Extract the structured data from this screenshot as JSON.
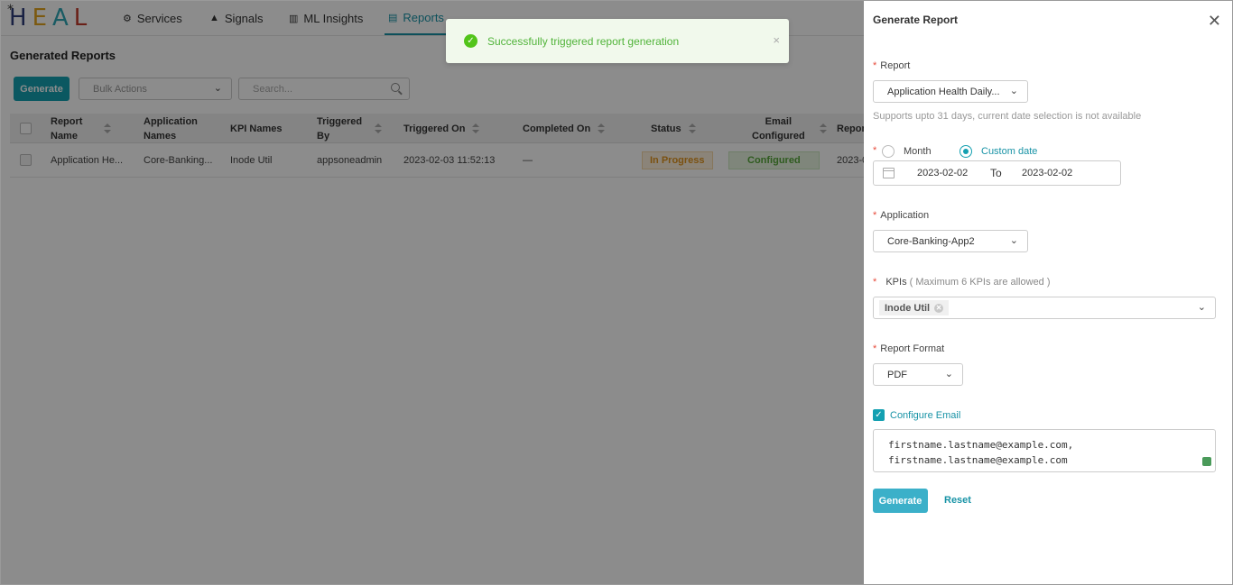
{
  "nav": {
    "logo": "HEAL",
    "items": [
      {
        "label": "Services",
        "icon": "gears-icon"
      },
      {
        "label": "Signals",
        "icon": "warning-icon"
      },
      {
        "label": "ML Insights",
        "icon": "bar-chart-icon"
      },
      {
        "label": "Reports",
        "icon": "document-icon",
        "active": true
      }
    ]
  },
  "page": {
    "title": "Generated Reports",
    "generate_label": "Generate",
    "bulk_actions_placeholder": "Bulk Actions",
    "search_placeholder": "Search..."
  },
  "table": {
    "headers": [
      "Report Name",
      "Application Names",
      "KPI Names",
      "Triggered By",
      "Triggered On",
      "Completed On",
      "Status",
      "Email Configured",
      "Repor"
    ],
    "header_lines": {
      "report_name": [
        "Report",
        "Name"
      ],
      "application_names": [
        "Application",
        "Names"
      ],
      "triggered_by": [
        "Triggered",
        "By"
      ],
      "email_configured": [
        "Email",
        "Configured"
      ]
    },
    "rows": [
      {
        "report_name": "Application He...",
        "application_names": "Core-Banking...",
        "kpi_names": "Inode Util",
        "triggered_by": "appsoneadmin",
        "triggered_on": "2023-02-03 11:52:13",
        "completed_on": "—",
        "status": "In Progress",
        "email_configured": "Configured",
        "report_trunc": "2023-0"
      }
    ]
  },
  "toast": {
    "message": "Successfully triggered report generation",
    "close": "×"
  },
  "drawer": {
    "title": "Generate Report",
    "close": "✕",
    "report_label": "Report",
    "report_value": "Application Health Daily...",
    "report_hint": "Supports upto 31 days, current date selection is not available",
    "radio_month": "Month",
    "radio_custom": "Custom date",
    "date_from": "2023-02-02",
    "date_to_label": "To",
    "date_to": "2023-02-02",
    "application_label": "Application",
    "application_value": "Core-Banking-App2",
    "kpis_label": "KPIs",
    "kpis_note": "( Maximum 6 KPIs are allowed )",
    "kpi_tag": "Inode Util",
    "format_label": "Report Format",
    "format_value": "PDF",
    "configure_email_label": "Configure Email",
    "email_line1": "firstname.lastname@example.com,",
    "email_line2": "firstname.lastname@example.com",
    "generate_label": "Generate",
    "reset_label": "Reset"
  },
  "colors": {
    "accent": "#14a0b1",
    "success": "#52c41a",
    "warning": "#e0941e"
  }
}
